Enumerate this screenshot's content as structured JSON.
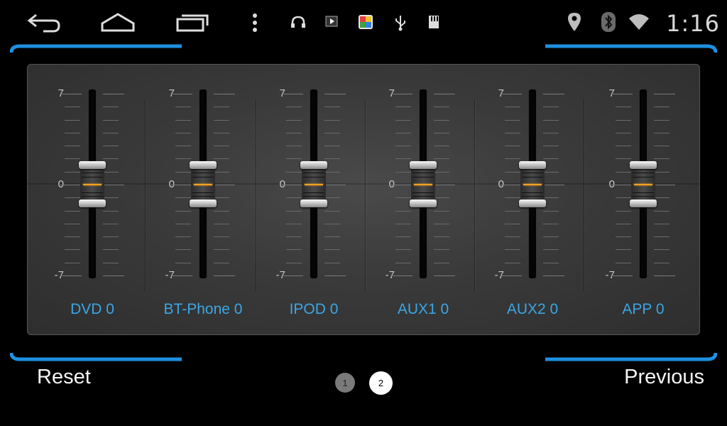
{
  "status_bar": {
    "time": "1:16",
    "nav_buttons": [
      "back-icon",
      "home-icon",
      "recent-apps-icon",
      "menu-icon"
    ],
    "notification_icons": [
      "headset-icon",
      "media-play-icon",
      "app-store-icon",
      "usb-icon",
      "sd-card-icon"
    ],
    "system_icons": [
      "location-icon",
      "bluetooth-icon",
      "wifi-icon"
    ]
  },
  "mixer": {
    "scale": {
      "max": "7",
      "mid": "0",
      "min": "-7"
    },
    "channels": [
      {
        "label": "DVD 0",
        "value": 0
      },
      {
        "label": "BT-Phone 0",
        "value": 0
      },
      {
        "label": "IPOD 0",
        "value": 0
      },
      {
        "label": "AUX1 0",
        "value": 0
      },
      {
        "label": "AUX2 0",
        "value": 0
      },
      {
        "label": "APP 0",
        "value": 0
      }
    ]
  },
  "footer": {
    "reset_label": "Reset",
    "previous_label": "Previous",
    "pages": [
      "1",
      "2"
    ],
    "current_page": "2"
  },
  "colors": {
    "accent_blue": "#1e90e0",
    "label_blue": "#3aa6e6",
    "knob_indicator": "#f0a020"
  }
}
